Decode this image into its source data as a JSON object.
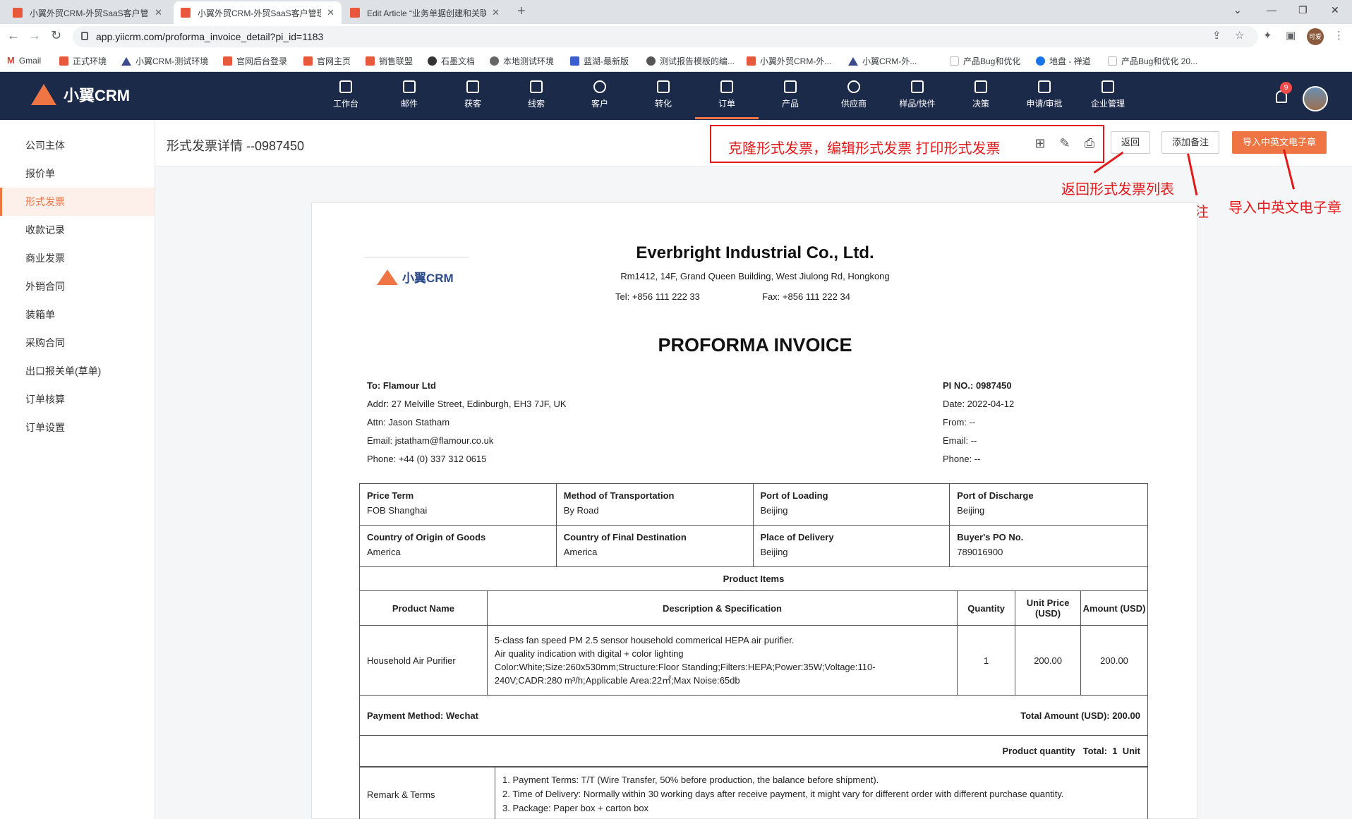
{
  "browser": {
    "tabs": [
      {
        "title": "小翼外贸CRM-外贸SaaS客户管理",
        "active": false
      },
      {
        "title": "小翼外贸CRM-外贸SaaS客户管理",
        "active": true
      },
      {
        "title": "Edit Article “业务单据创建和关联",
        "active": false
      }
    ],
    "url": "app.yiicrm.com/proforma_invoice_detail?pi_id=1183",
    "profile_initials": "可爱",
    "bookmarks": [
      "Gmail",
      "正式环境",
      "小翼CRM-测试环境",
      "官网后台登录",
      "官网主页",
      "销售联盟",
      "石墨文档",
      "本地测试环境",
      "蓝湖-最新版",
      "测试报告模板的编...",
      "小翼外贸CRM-外...",
      "小翼CRM-外...",
      "产品Bug和优化",
      "地盘 - 禅道",
      "产品Bug和优化 20..."
    ]
  },
  "app": {
    "brand": "小翼CRM",
    "nav": [
      "工作台",
      "邮件",
      "获客",
      "线索",
      "客户",
      "转化",
      "订单",
      "产品",
      "供应商",
      "样品/快件",
      "决策",
      "申请/审批",
      "企业管理"
    ],
    "active_nav": "订单",
    "notification_count": "9"
  },
  "sidebar": {
    "items": [
      "公司主体",
      "报价单",
      "形式发票",
      "收款记录",
      "商业发票",
      "外销合同",
      "装箱单",
      "采购合同",
      "出口报关单(草单)",
      "订单核算",
      "订单设置"
    ],
    "active": "形式发票"
  },
  "page": {
    "title": "形式发票详情 --0987450",
    "buttons": {
      "back": "返回",
      "add_note": "添加备注",
      "import_seal": "导入中英文电子章"
    }
  },
  "annotations": {
    "toolbar": "克隆形式发票，编辑形式发票  打印形式发票",
    "back": "返回形式发票列表",
    "add_note": "添加备注",
    "import_seal": "导入中英文电子章"
  },
  "invoice": {
    "logo_text": "小翼CRM",
    "company_name": "Everbright Industrial Co., Ltd.",
    "company_address": "Rm1412, 14F, Grand Queen Building, West Jiulong Rd, Hongkong",
    "tel": "Tel: +856 111 222 33",
    "fax": "Fax: +856 111 222 34",
    "doc_title": "PROFORMA INVOICE",
    "to": "To: Flamour Ltd",
    "addr": "Addr: 27 Melville Street, Edinburgh, EH3 7JF, UK",
    "attn": "Attn: Jason Statham",
    "email": "Email: jstatham@flamour.co.uk",
    "phone": "Phone: +44 (0) 337 312 0615",
    "pi_no": "PI NO.: 0987450",
    "date": "Date: 2022-04-12",
    "from": "From: --",
    "from_email": "Email: --",
    "from_phone": "Phone: --",
    "terms_grid": [
      {
        "label": "Price Term",
        "value": "FOB Shanghai"
      },
      {
        "label": "Method of Transportation",
        "value": "By Road"
      },
      {
        "label": "Port of Loading",
        "value": "Beijing"
      },
      {
        "label": "Port of Discharge",
        "value": "Beijing"
      },
      {
        "label": "Country of Origin of Goods",
        "value": "America"
      },
      {
        "label": "Country of Final Destination",
        "value": "America"
      },
      {
        "label": "Place of Delivery",
        "value": "Beijing"
      },
      {
        "label": "Buyer's PO No.",
        "value": "789016900"
      }
    ],
    "product_items_title": "Product Items",
    "columns": [
      "Product Name",
      "Description & Specification",
      "Quantity",
      "Unit Price (USD)",
      "Amount (USD)"
    ],
    "items": [
      {
        "name": "Household Air Purifier",
        "desc_lines": [
          "5-class fan speed PM 2.5 sensor household commerical HEPA air purifier.",
          "Air quality indication with digital + color lighting",
          "Color:White;Size:260x530mm;Structure:Floor Standing;Filters:HEPA;Power:35W;Voltage:110-",
          "240V;CADR:280 m³/h;Applicable Area:22㎡;Max Noise:65db"
        ],
        "quantity": "1",
        "unit_price": "200.00",
        "amount": "200.00"
      }
    ],
    "payment_method": "Payment Method: Wechat",
    "total_amount": "Total Amount (USD): 200.00",
    "product_quantity": "Product quantity   Total:  1  Unit",
    "remark_label": "Remark & Terms",
    "remarks": [
      "1. Payment Terms:  T/T (Wire Transfer, 50% before production, the balance before shipment).",
      "2. Time of Delivery:  Normally within 30 working days after receive payment, it might vary for different order with different purchase quantity.",
      "3. Package: Paper box + carton box"
    ]
  }
}
